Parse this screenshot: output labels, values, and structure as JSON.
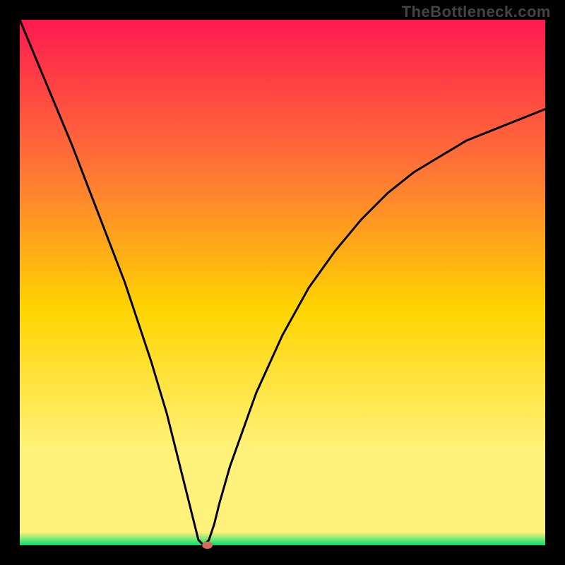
{
  "watermark": "TheBottleneck.com",
  "colors": {
    "top": "#ff1a50",
    "q1": "#ff7a33",
    "mid": "#ffd400",
    "q3": "#fff27a",
    "bottom": "#00e070",
    "curve": "#000000",
    "dot": "#d46a62",
    "frame": "#000000"
  },
  "chart_data": {
    "type": "line",
    "title": "",
    "xlabel": "",
    "ylabel": "",
    "xlim": [
      0,
      100
    ],
    "ylim": [
      0,
      100
    ],
    "min_x": 35,
    "x": [
      0,
      5,
      10,
      15,
      20,
      25,
      28,
      30,
      32,
      33,
      34,
      35,
      36,
      37,
      38,
      40,
      45,
      50,
      55,
      60,
      65,
      70,
      75,
      80,
      85,
      90,
      95,
      100
    ],
    "values": [
      100,
      88,
      76,
      63,
      50,
      35,
      25,
      17,
      9,
      5,
      1,
      0,
      1,
      4,
      8,
      15,
      29,
      40,
      49,
      56,
      62,
      67,
      71,
      74,
      77,
      79,
      81,
      83
    ],
    "dot": {
      "x": 35.7,
      "y": 0,
      "rx": 1.0,
      "ry": 0.7
    }
  }
}
